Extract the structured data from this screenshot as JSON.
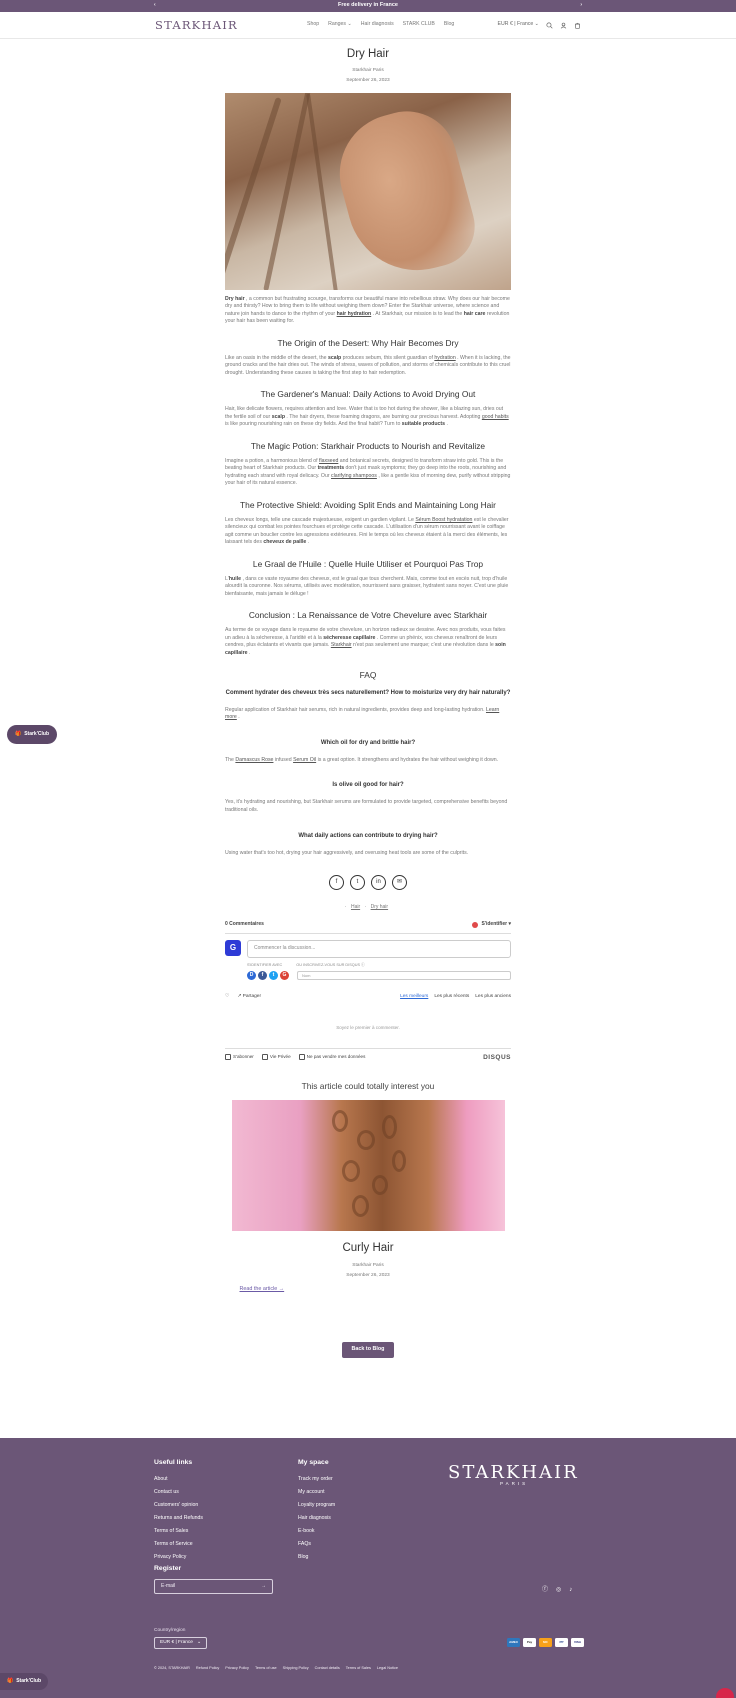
{
  "announcement": {
    "text": "Free delivery in France",
    "prev": "‹",
    "next": "›"
  },
  "header": {
    "logo": "STARKHAIR",
    "nav": [
      "Shop",
      "Ranges ⌄",
      "Hair diagnosis",
      "STARK CLUB",
      "Blog"
    ],
    "currency": "EUR € | France ⌄"
  },
  "article": {
    "title": "Dry Hair",
    "author": "Starkhair Paris",
    "date": "September 26, 2023",
    "sections": [
      {
        "type": "p",
        "html": "<b>Dry hair</b> , a common but frustrating scourge, transforms our beautiful mane into rebellious straw. Why does our hair become dry and thirsty? How to bring them to life without weighing them down? Enter the Starkhair universe, where science and nature join hands to dance to the rhythm of your <span class='ul'><b>hair hydration</b></span> . At Starkhair, our mission is to lead the <b>hair care</b> revolution your hair has been waiting for."
      },
      {
        "type": "h",
        "text": "The Origin of the Desert: Why Hair Becomes Dry"
      },
      {
        "type": "p",
        "html": "Like an oasis in the middle of the desert, the <b>scalp</b> produces sebum, this silent guardian of <span class='ul'>hydration</span> . When it is lacking, the ground cracks and the hair dries out. The winds of stress, waves of pollution, and storms of chemicals contribute to this cruel drought. Understanding these causes is taking the first step to hair redemption."
      },
      {
        "type": "h",
        "text": "The Gardener's Manual: Daily Actions to Avoid Drying Out"
      },
      {
        "type": "p",
        "html": "Hair, like delicate flowers, requires attention and love. Water that is too hot during the shower, like a blazing sun, dries out the fertile soil of our <b>scalp</b> . The hair dryers, these foaming dragons, are burning our precious harvest. Adopting <span class='ul'>good habits</span> is like pouring nourishing rain on these dry fields. And the final habit? Turn to <b>suitable products</b> ."
      },
      {
        "type": "h",
        "text": "The Magic Potion: Starkhair Products to Nourish and Revitalize"
      },
      {
        "type": "p",
        "html": "Imagine a potion, a harmonious blend of <span class='ul'>flaxseed</span> and botanical secrets, designed to transform straw into gold. This is the beating heart of Starkhair products. Our <b>treatments</b> don't just mask symptoms; they go deep into the roots, nourishing and hydrating each strand with royal delicacy. Our <span class='ul'>clarifying shampoos</span> , like a gentle kiss of morning dew, purify without stripping your hair of its natural essence."
      },
      {
        "type": "h",
        "text": "The Protective Shield: Avoiding Split Ends and Maintaining Long Hair"
      },
      {
        "type": "p",
        "html": "Les cheveux longs, telle une cascade majestueuse, exigent un gardien vigilant. Le <span class='ul'>Sérum Boost hydratation</span> est le chevalier silencieux qui combat les pointes fourchues et protège cette cascade. L'utilisation d'un sérum nourrissant avant le coiffage agit comme un bouclier contre les agressions extérieures. Fini le temps où les cheveux étaient à la merci des éléments, les laissant tels des <b>cheveux de paille</b> ."
      },
      {
        "type": "h",
        "text": "Le Graal de l'Huile : Quelle Huile Utiliser et Pourquoi Pas Trop"
      },
      {
        "type": "p",
        "html": "L'<b>huile</b> , dans ce vaste royaume des cheveux, est le graal que tous cherchent. Mais, comme tout en excès nuit, trop d'huile alourdit la couronne. Nos sérums, utilisés avec modération, nourrissent sans graisser, hydratent sans noyer. C'est une pluie bienfaisante, mais jamais le déluge !"
      },
      {
        "type": "h",
        "text": "Conclusion : La Renaissance de Votre Chevelure avec Starkhair"
      },
      {
        "type": "p",
        "html": "Au terme de ce voyage dans le royaume de votre chevelure, un horizon radieux se dessine. Avec nos produits, vous faites un adieu à la sécheresse, à l'aridité et à la <b>sécheresse capillaire</b> . Comme un phénix, vos cheveux renaîtront de leurs cendres, plus éclatants et vivants que jamais. <span class='ul'>Starkhair</span> n'est pas seulement une marque; c'est une révolution dans le <b>soin capillaire</b> ."
      }
    ],
    "faq_title": "FAQ",
    "faq": [
      {
        "q": "Comment hydrater des cheveux très secs naturellement? How to moisturize very dry hair naturally?",
        "a": "Regular application of Starkhair hair serums, rich in natural ingredients, provides deep and long-lasting hydration. <span class='ul'>Learn more</span> ."
      },
      {
        "q": "Which oil for dry and brittle hair?",
        "a": "The <span class='ul'>Damascus Rose</span> infused <span class='ul'>Serum Oil</span> is a great option. It strengthens and hydrates the hair without weighing it down."
      },
      {
        "q": "Is olive oil good for hair?",
        "a": "Yes, it's hydrating and nourishing, but Starkhair serums are formulated to provide targeted, comprehensive benefits beyond traditional oils."
      },
      {
        "q": "What daily actions can contribute to drying hair?",
        "a": "Using water that's too hot, drying your hair aggressively, and overusing heat tools are some of the culprits."
      }
    ],
    "share": [
      "f",
      "t",
      "in",
      "✉"
    ],
    "tags": [
      "Hair",
      "Dry hair"
    ]
  },
  "comments": {
    "count_label": "0 Commentaires",
    "login_label": "S'identifier ▾",
    "input_placeholder": "Commencer la discussion...",
    "connect_label": "S'IDENTIFIER AVEC",
    "or_label": "OU INSCRIVEZ-VOUS SUR DISQUS ⓘ",
    "name_placeholder": "Nom",
    "favorite_label": "♡",
    "share_label": "↗ Partager",
    "sorts": [
      "Les meilleurs",
      "Les plus récents",
      "Les plus anciens"
    ],
    "empty_label": "Soyez le premier à commenter.",
    "footer_links": [
      "S'abonner",
      "Vie Privée",
      "Ne pas vendre mes données"
    ],
    "brand": "DISQUS"
  },
  "related": {
    "title": "This article could totally interest you",
    "post_title": "Curly Hair",
    "author": "Starkhair Paris",
    "date": "September 26, 2023",
    "read_more": "Read the article →"
  },
  "back_button": "Back to Blog",
  "footer": {
    "useful_links_title": "Useful links",
    "useful_links": [
      "About",
      "Contact us",
      "Customers' opinion",
      "Returns and Refunds",
      "Terms of Sales",
      "Terms of Service",
      "Privacy Policy"
    ],
    "my_space_title": "My space",
    "my_space": [
      "Track my order",
      "My account",
      "Loyalty program",
      "Hair diagnosis",
      "E-book",
      "FAQs",
      "Blog"
    ],
    "logo": "STARKHAIR",
    "logo_sub": "PARIS",
    "register_title": "Register",
    "email_placeholder": "E-mail",
    "country_label": "Country/region",
    "country_value": "EUR € | France",
    "payments": [
      "AMEX",
      "Pay",
      "MC",
      "PP",
      "VISA"
    ],
    "legal": [
      "© 2024, STARKHAIR",
      "Refund Policy",
      "Privacy Policy",
      "Terms of use",
      "Shipping Policy",
      "Contact details",
      "Terms of Sales",
      "Legal Notice"
    ]
  },
  "stark_club": {
    "label": "Stark'Club"
  }
}
